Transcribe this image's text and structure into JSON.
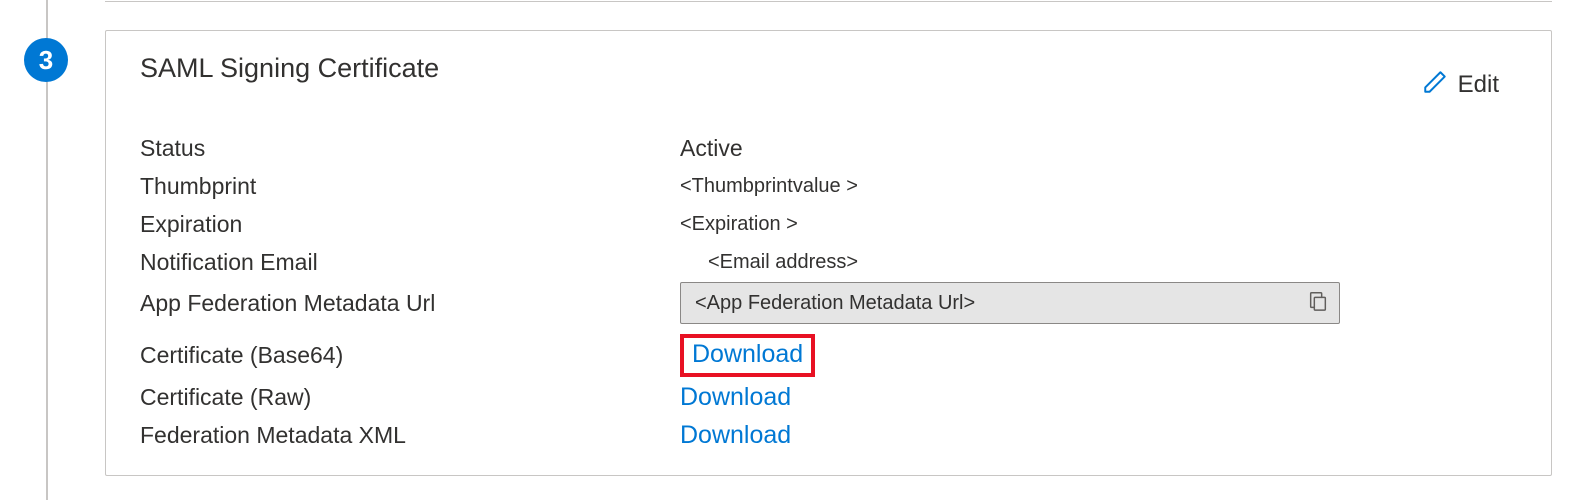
{
  "step": {
    "number": "3"
  },
  "card": {
    "title": "SAML Signing Certificate",
    "edit_label": "Edit"
  },
  "fields": {
    "status": {
      "label": "Status",
      "value": "Active"
    },
    "thumbprint": {
      "label": "Thumbprint",
      "value": "<Thumbprintvalue >"
    },
    "expiration": {
      "label": "Expiration",
      "value": "<Expiration >"
    },
    "notification_email": {
      "label": "Notification Email",
      "value": "<Email address>"
    },
    "metadata_url": {
      "label": "App Federation Metadata Url",
      "value": "<App Federation  Metadata Url>"
    },
    "cert_base64": {
      "label": "Certificate (Base64)",
      "link": "Download"
    },
    "cert_raw": {
      "label": "Certificate (Raw)",
      "link": "Download"
    },
    "fed_xml": {
      "label": "Federation Metadata XML",
      "link": "Download"
    }
  }
}
